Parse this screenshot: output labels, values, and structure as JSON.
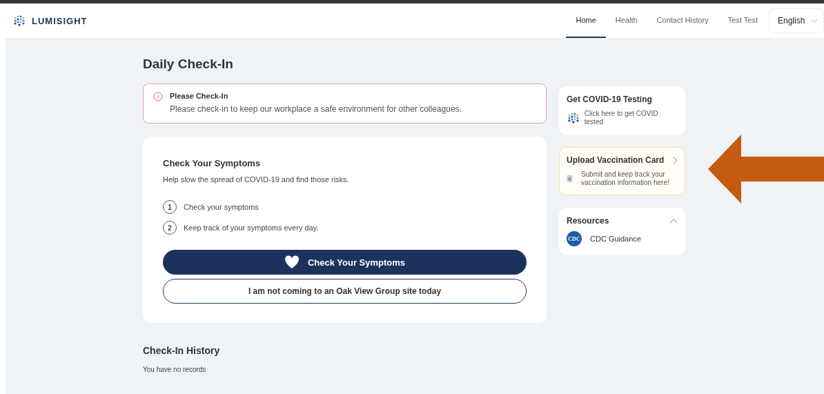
{
  "header": {
    "brand": "LUMISIGHT",
    "nav": [
      {
        "label": "Home",
        "selected": true
      },
      {
        "label": "Health",
        "selected": false
      },
      {
        "label": "Contact History",
        "selected": false
      },
      {
        "label": "Test Test",
        "selected": false
      }
    ],
    "language": "English"
  },
  "page_title": "Daily Check-In",
  "alert": {
    "title": "Please Check-In",
    "message": "Please check-in to keep our workplace a safe environment for other colleagues."
  },
  "symptoms_card": {
    "title": "Check Your Symptoms",
    "subtitle": "Help slow the spread of COVID-19 and find those risks.",
    "steps": [
      {
        "number": "1",
        "text": "Check your symptoms"
      },
      {
        "number": "2",
        "text": "Keep track of your symptoms every day."
      }
    ],
    "primary_button": "Check Your Symptoms",
    "secondary_button": "I am not coming to an Oak View Group site today"
  },
  "side_cards": [
    {
      "kind": "testing",
      "title": "Get COVID-19 Testing",
      "text": "Click here to get COVID tested"
    },
    {
      "kind": "vaccination",
      "title": "Upload Vaccination Card",
      "text": "Submit and keep track your vaccination information here!"
    },
    {
      "kind": "resources",
      "title": "Resources",
      "expanded": true,
      "links": [
        {
          "badge": "CDC",
          "label": "CDC Guidance"
        }
      ]
    }
  ],
  "history": {
    "title": "Check-In History",
    "empty_text": "You have no records"
  }
}
